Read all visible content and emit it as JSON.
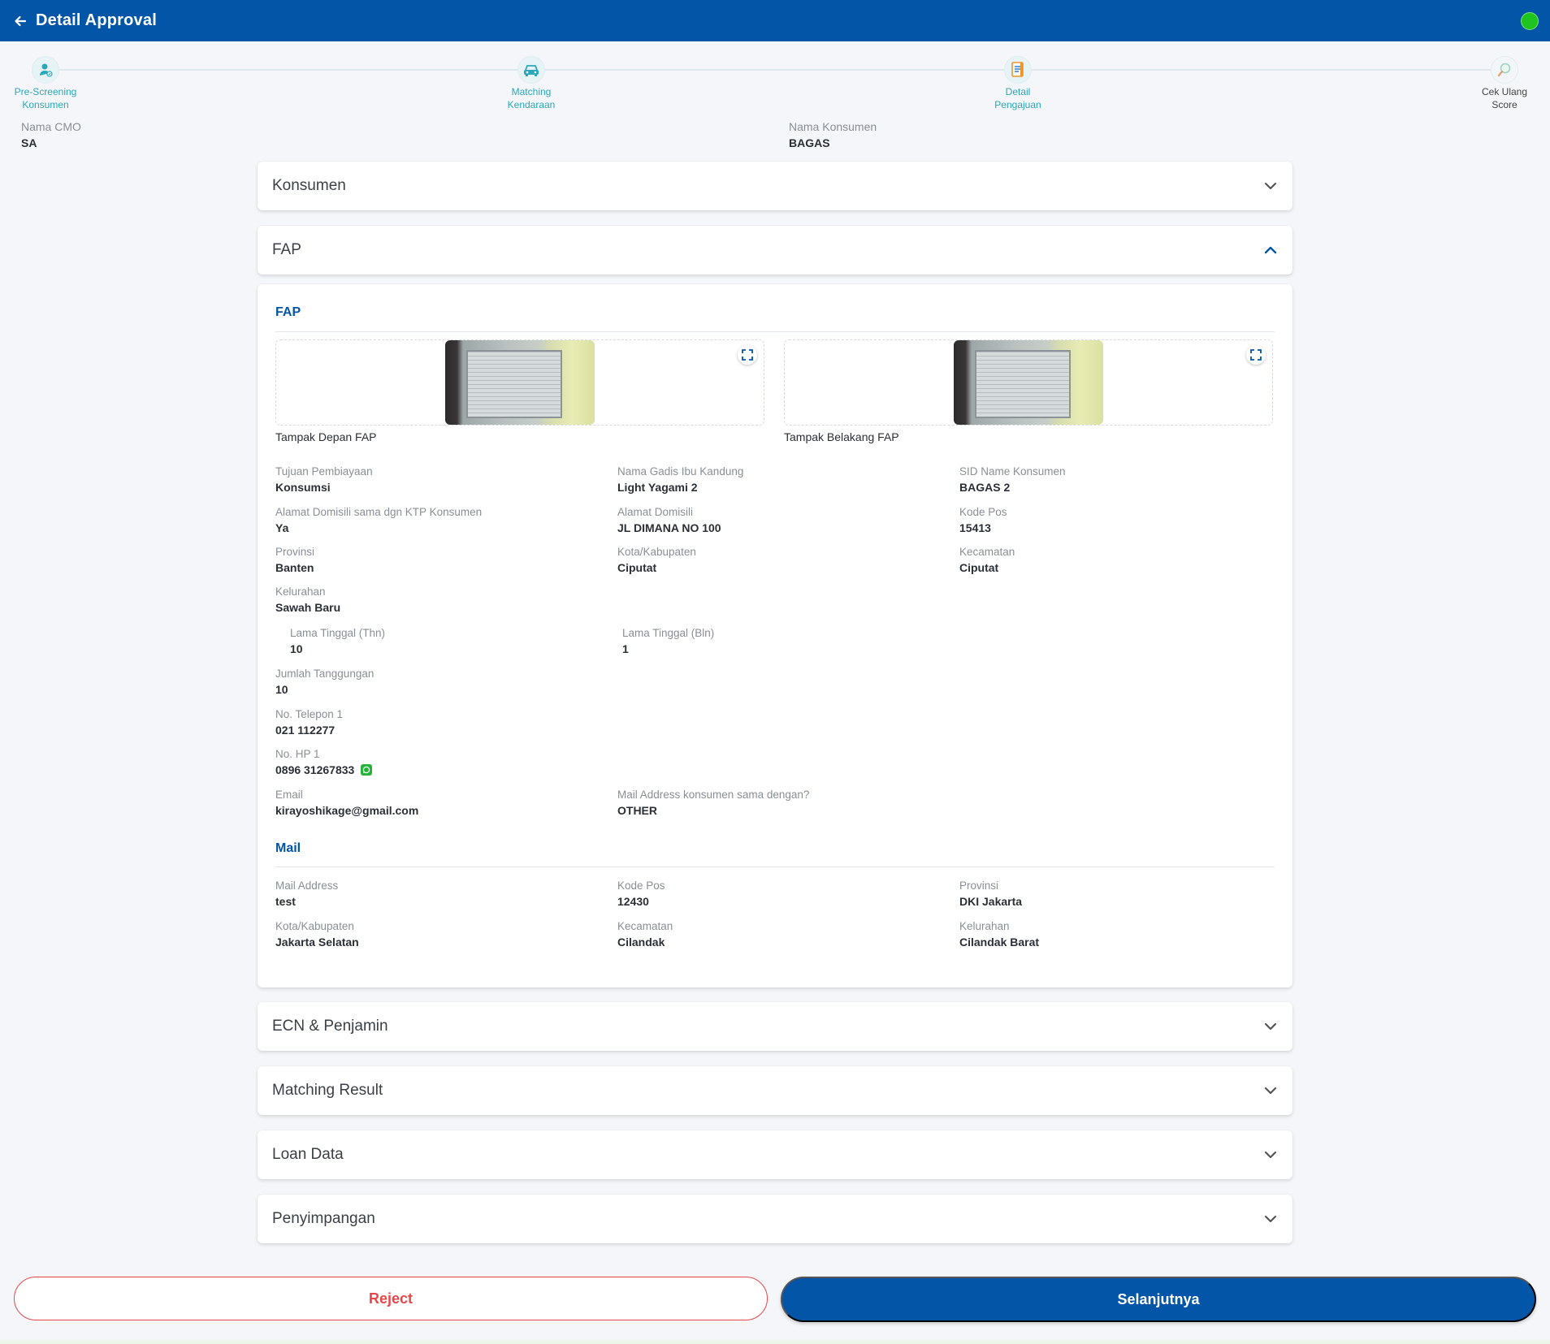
{
  "header": {
    "title": "Detail Approval"
  },
  "stepper": [
    {
      "label_line1": "Pre-Screening",
      "label_line2": "Konsumen",
      "icon": "user-check-icon"
    },
    {
      "label_line1": "Matching",
      "label_line2": "Kendaraan",
      "icon": "car-icon"
    },
    {
      "label_line1": "Detail",
      "label_line2": "Pengajuan",
      "icon": "document-icon"
    },
    {
      "label_line1": "Cek Ulang",
      "label_line2": "Score",
      "icon": "magnifier-icon"
    }
  ],
  "info": {
    "cmo_label": "Nama CMO",
    "cmo_value": "SA",
    "konsumen_label": "Nama Konsumen",
    "konsumen_value": "BAGAS"
  },
  "accordions": {
    "konsumen": "Konsumen",
    "fap": "FAP",
    "ecn": "ECN & Penjamin",
    "matching": "Matching Result",
    "loan": "Loan Data",
    "penyimpangan": "Penyimpangan"
  },
  "fap": {
    "section_title": "FAP",
    "photo_front_caption": "Tampak Depan FAP",
    "photo_back_caption": "Tampak Belakang FAP",
    "fields": {
      "tujuan": {
        "label": "Tujuan Pembiayaan",
        "value": "Konsumsi"
      },
      "ibu": {
        "label": "Nama Gadis Ibu Kandung",
        "value": "Light Yagami 2"
      },
      "sid": {
        "label": "SID Name Konsumen",
        "value": "BAGAS 2"
      },
      "domisili_sama": {
        "label": "Alamat Domisili sama dgn KTP Konsumen",
        "value": "Ya"
      },
      "alamat": {
        "label": "Alamat Domisili",
        "value": "JL DIMANA NO 100"
      },
      "kodepos": {
        "label": "Kode Pos",
        "value": "15413"
      },
      "provinsi": {
        "label": "Provinsi",
        "value": "Banten"
      },
      "kota": {
        "label": "Kota/Kabupaten",
        "value": "Ciputat"
      },
      "kecamatan": {
        "label": "Kecamatan",
        "value": "Ciputat"
      },
      "kelurahan": {
        "label": "Kelurahan",
        "value": "Sawah Baru"
      },
      "lama_thn": {
        "label": "Lama Tinggal (Thn)",
        "value": "10"
      },
      "lama_bln": {
        "label": "Lama Tinggal (Bln)",
        "value": "1"
      },
      "tanggungan": {
        "label": "Jumlah Tanggungan",
        "value": "10"
      },
      "telepon": {
        "label": "No. Telepon 1",
        "value": "021 112277"
      },
      "hp": {
        "label": "No. HP 1",
        "value": "0896 31267833"
      },
      "email": {
        "label": "Email",
        "value": "kirayoshikage@gmail.com"
      },
      "mail_sama": {
        "label": "Mail Address konsumen sama dengan?",
        "value": "OTHER"
      }
    }
  },
  "mail": {
    "section_title": "Mail",
    "fields": {
      "address": {
        "label": "Mail Address",
        "value": "test"
      },
      "kodepos": {
        "label": "Kode Pos",
        "value": "12430"
      },
      "provinsi": {
        "label": "Provinsi",
        "value": "DKI Jakarta"
      },
      "kota": {
        "label": "Kota/Kabupaten",
        "value": "Jakarta Selatan"
      },
      "kecamatan": {
        "label": "Kecamatan",
        "value": "Cilandak"
      },
      "kelurahan": {
        "label": "Kelurahan",
        "value": "Cilandak Barat"
      }
    }
  },
  "actions": {
    "reject": "Reject",
    "next": "Selanjutnya"
  },
  "colors": {
    "primary": "#0356a7",
    "reject": "#e6474a",
    "status": "#1fc41f",
    "accent": "#2aa7b8"
  }
}
